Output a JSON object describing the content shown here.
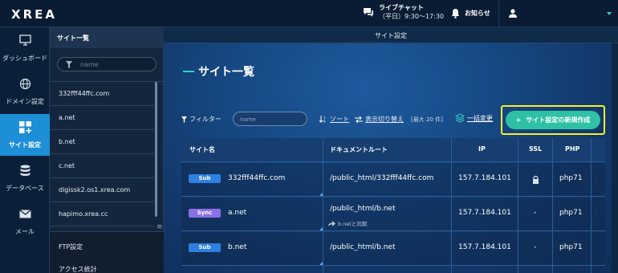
{
  "header": {
    "logo": "XREA",
    "livechat_title": "ライブチャット",
    "livechat_hours": "（平日）9:30～17:30",
    "notice_label": "お知らせ"
  },
  "leftnav": [
    {
      "label": "ダッシュボード",
      "icon": "monitor-icon",
      "active": false
    },
    {
      "label": "ドメイン設定",
      "icon": "globe-icon",
      "active": false
    },
    {
      "label": "サイト設定",
      "icon": "grid-plus-icon",
      "active": true
    },
    {
      "label": "データベース",
      "icon": "database-icon",
      "active": false
    },
    {
      "label": "メール",
      "icon": "mail-icon",
      "active": false
    }
  ],
  "sidebar": {
    "title": "サイト一覧",
    "search_placeholder": "name",
    "items": [
      {
        "label": "332fff44ffc.com"
      },
      {
        "label": "a.net"
      },
      {
        "label": "b.net"
      },
      {
        "label": "c.net"
      },
      {
        "label": "digissk2.os1.xrea.com"
      },
      {
        "label": "hapimo.xrea.cc"
      }
    ],
    "bottom_items": [
      {
        "label": "FTP設定"
      },
      {
        "label": "アクセス統計"
      }
    ]
  },
  "main": {
    "subheader": "サイト設定",
    "title": "サイト一覧",
    "toolbar": {
      "filter_label": "フィルター",
      "filter_placeholder": "name",
      "sort_label": "ソート",
      "toggle_label": "表示切り替え",
      "max_label": "[最大 20 件]",
      "bulk_label": "一括変更",
      "new_button": "サイト設定の新規作成"
    },
    "table": {
      "headers": {
        "site": "サイト名",
        "docroot": "ドキュメントルート",
        "ip": "IP",
        "ssl": "SSL",
        "php": "PHP"
      },
      "rows": [
        {
          "badge": "Sub",
          "badge_color": "#2f7fe0",
          "name": "332fff44ffc.com",
          "docroot": "/public_html/332fff44ffc.com",
          "sync_note": "",
          "ip": "157.7.184.101",
          "ssl": "lock-icon",
          "php": "php71"
        },
        {
          "badge": "Sync",
          "badge_color": "#8b6fe6",
          "name": "a.net",
          "docroot": "/public_html/b.net",
          "sync_note": "b.netと同期",
          "ip": "157.7.184.101",
          "ssl": "-",
          "php": "php71"
        },
        {
          "badge": "Sub",
          "badge_color": "#2f7fe0",
          "name": "b.net",
          "docroot": "/public_html/b.net",
          "sync_note": "",
          "ip": "157.7.184.101",
          "ssl": "-",
          "php": "php71"
        }
      ]
    }
  },
  "colors": {
    "accent": "#3ad0c0",
    "active_nav": "#1c8fd6",
    "highlight": "#f7ef2a",
    "button": "#2fc1a5"
  }
}
